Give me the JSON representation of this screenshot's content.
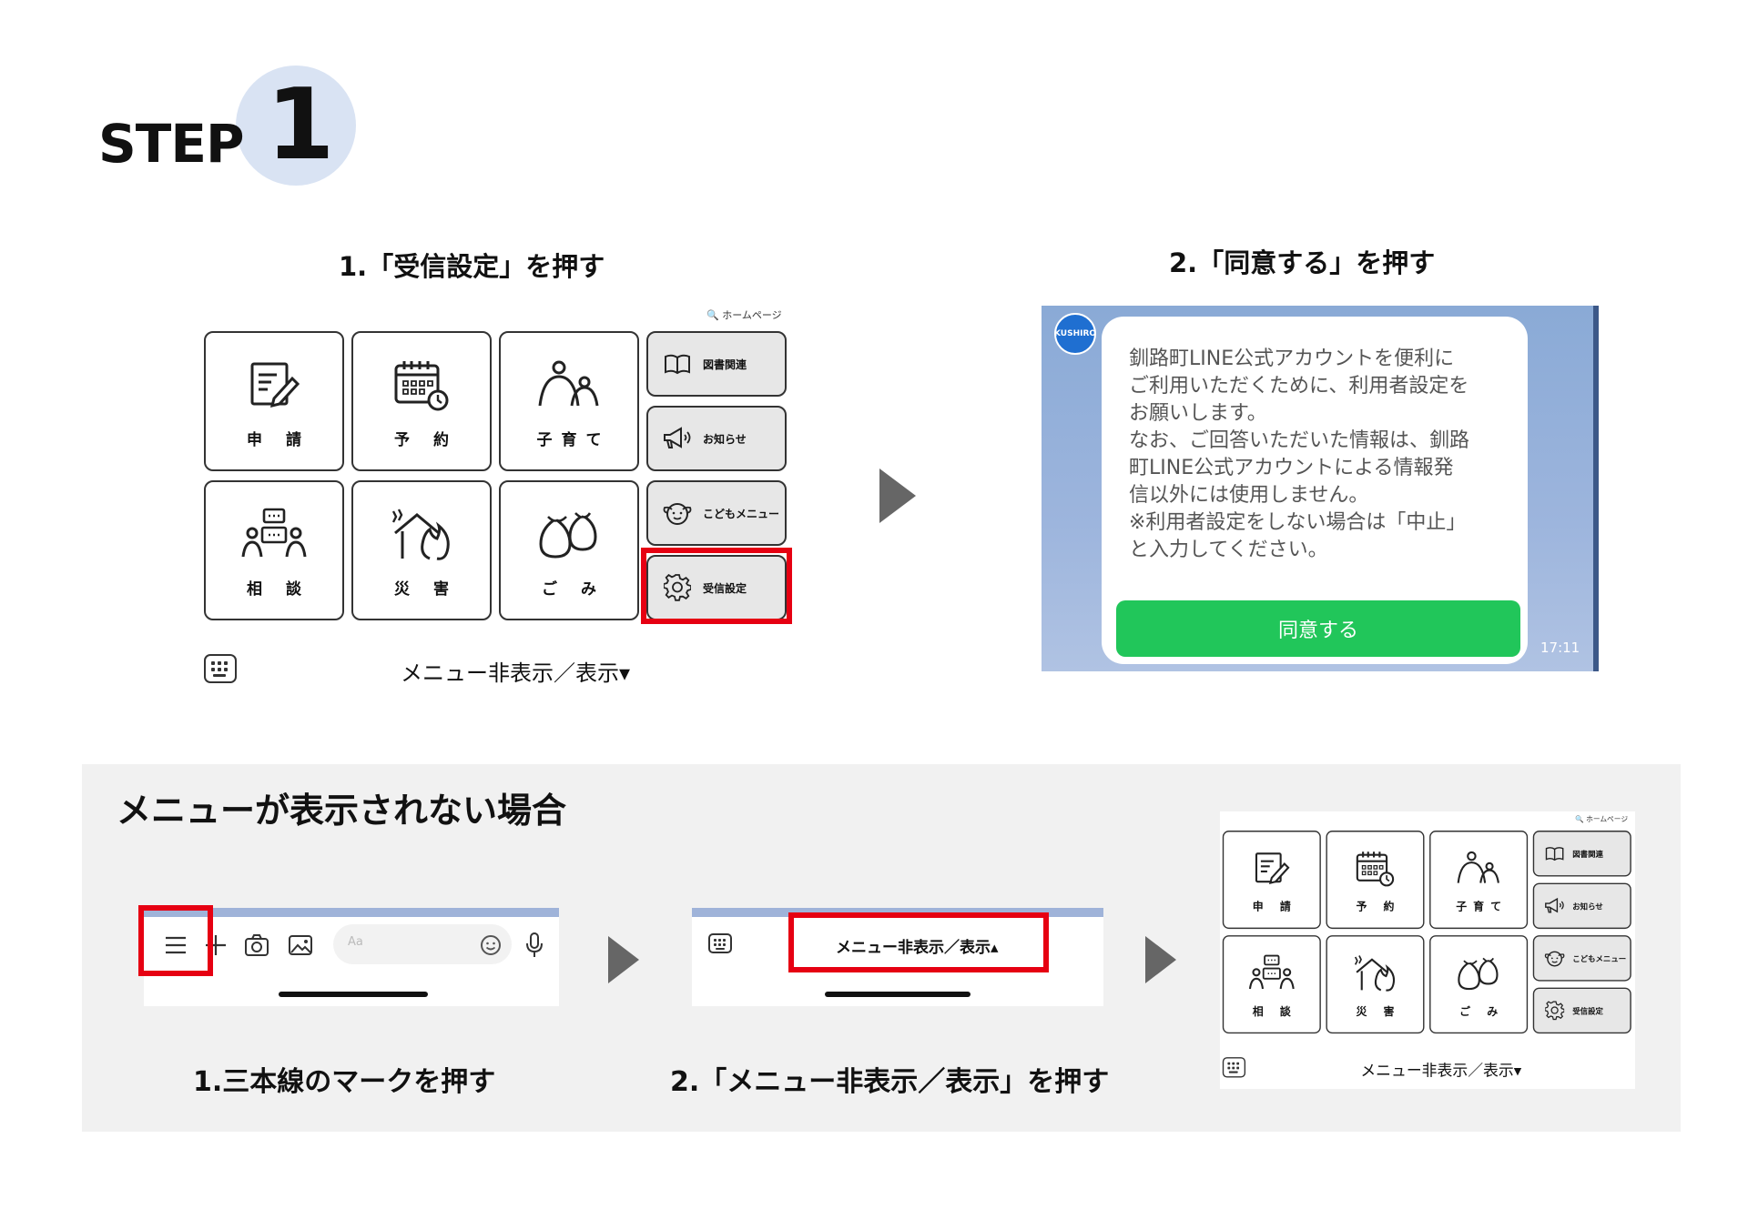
{
  "header": {
    "step_word": "STEP",
    "step_number": "1"
  },
  "step1": {
    "title": "1.「受信設定」を押す"
  },
  "step2": {
    "title": "2.「同意する」を押す"
  },
  "rich_menu": {
    "homepage": "ホームページ",
    "big_tiles": [
      {
        "label": "申 請",
        "icon": "application-form-icon"
      },
      {
        "label": "予 約",
        "icon": "calendar-clock-icon"
      },
      {
        "label": "子育て",
        "icon": "parent-child-icon"
      },
      {
        "label": "相 談",
        "icon": "consultation-icon"
      },
      {
        "label": "災 害",
        "icon": "disaster-house-fire-icon"
      },
      {
        "label": "ご み",
        "icon": "garbage-bags-icon"
      }
    ],
    "small_tiles": [
      {
        "label": "図書関連",
        "icon": "book-icon"
      },
      {
        "label": "お知らせ",
        "icon": "megaphone-icon"
      },
      {
        "label": "こどもメニュー",
        "icon": "child-face-icon"
      },
      {
        "label": "受信設定",
        "icon": "gear-icon"
      }
    ],
    "toggle": "メニュー非表示／表示▾"
  },
  "chat": {
    "avatar_text": "KUSHIRO",
    "message": "釧路町LINE公式アカウントを便利に\nご利用いただくために、利用者設定を\nお願いします。\nなお、ご回答いただいた情報は、釧路\n町LINE公式アカウントによる情報発\n信以外には使用しません。\n※利用者設定をしない場合は「中止」\nと入力してください。",
    "agree_button": "同意する",
    "time": "17:11"
  },
  "no_menu": {
    "title": "メニューが表示されない場合",
    "input_placeholder": "Aa",
    "bar_toggle": "メニュー非表示／表示▴",
    "caption1": "1.三本線のマークを押す",
    "caption2": "2.「メニュー非表示／表示」を押す"
  },
  "colors": {
    "accent_red": "#e60012",
    "line_green": "#21c65a",
    "step_circle": "#d9e3f3",
    "chat_bg": "#8aaad6"
  }
}
